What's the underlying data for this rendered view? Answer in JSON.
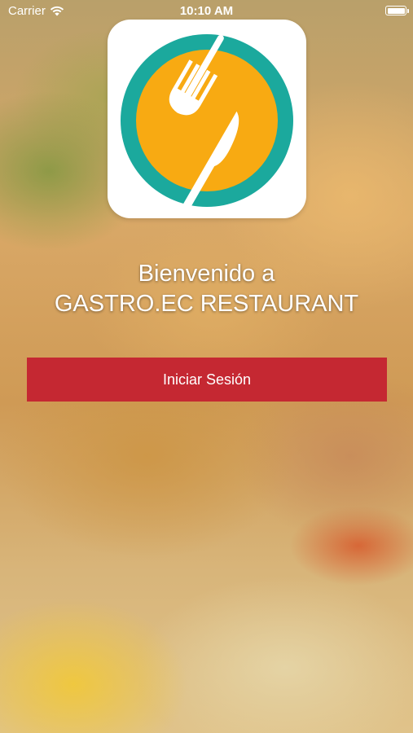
{
  "status_bar": {
    "carrier": "Carrier",
    "time": "10:10 AM",
    "icons": [
      "wifi-icon",
      "battery-icon"
    ]
  },
  "logo": {
    "icon": "fork-knife-plate-icon",
    "colors": {
      "ring": "#1ba99d",
      "plate": "#f8aa12",
      "cutlery": "#ffffff"
    }
  },
  "welcome": {
    "line1": "Bienvenido a",
    "line2": "GASTRO.EC RESTAURANT"
  },
  "login_button": {
    "label": "Iniciar Sesión",
    "color": "#c52832"
  }
}
